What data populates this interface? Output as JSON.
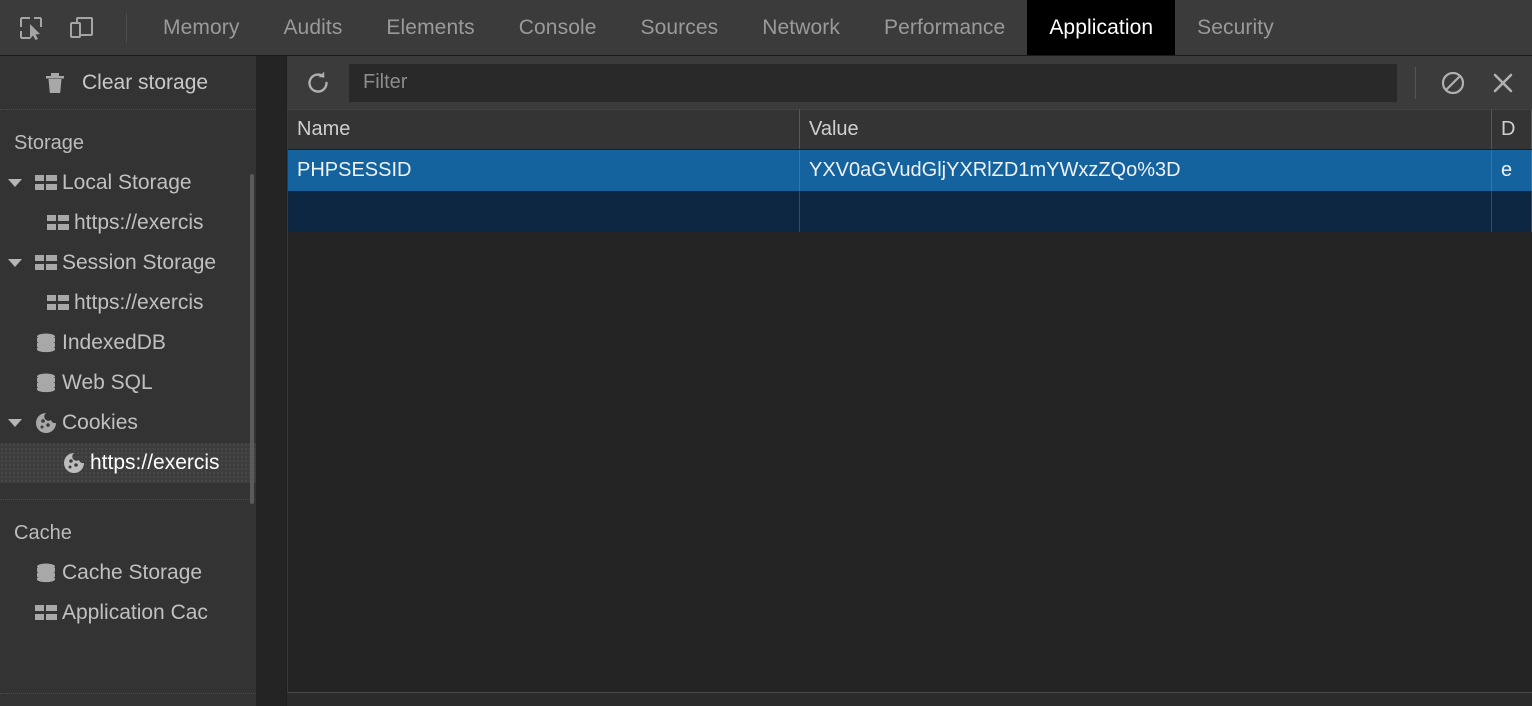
{
  "toolbar": {
    "inspect_icon": "inspect-element-icon",
    "device_icon": "device-toolbar-icon"
  },
  "tabs": [
    {
      "label": "Memory",
      "active": false
    },
    {
      "label": "Audits",
      "active": false
    },
    {
      "label": "Elements",
      "active": false
    },
    {
      "label": "Console",
      "active": false
    },
    {
      "label": "Sources",
      "active": false
    },
    {
      "label": "Network",
      "active": false
    },
    {
      "label": "Performance",
      "active": false
    },
    {
      "label": "Application",
      "active": true
    },
    {
      "label": "Security",
      "active": false
    }
  ],
  "sidebar": {
    "clear_storage": {
      "label": "Clear storage",
      "icon": "trash-icon"
    },
    "sections": [
      {
        "title": "Storage",
        "items": [
          {
            "label": "Local Storage",
            "icon": "table-icon",
            "indent": 1,
            "expandable": true,
            "expanded": true,
            "selected": false
          },
          {
            "label": "https://exercis",
            "icon": "table-icon",
            "indent": 2,
            "expandable": false,
            "expanded": false,
            "selected": false
          },
          {
            "label": "Session Storage",
            "icon": "table-icon",
            "indent": 1,
            "expandable": true,
            "expanded": true,
            "selected": false
          },
          {
            "label": "https://exercis",
            "icon": "table-icon",
            "indent": 2,
            "expandable": false,
            "expanded": false,
            "selected": false
          },
          {
            "label": "IndexedDB",
            "icon": "database-icon",
            "indent": 1,
            "expandable": false,
            "expanded": false,
            "selected": false
          },
          {
            "label": "Web SQL",
            "icon": "database-icon",
            "indent": 1,
            "expandable": false,
            "expanded": false,
            "selected": false
          },
          {
            "label": "Cookies",
            "icon": "cookie-icon",
            "indent": 1,
            "expandable": true,
            "expanded": true,
            "selected": false
          },
          {
            "label": "https://exercis",
            "icon": "cookie-icon",
            "indent": 3,
            "expandable": false,
            "expanded": false,
            "selected": true
          }
        ]
      },
      {
        "title": "Cache",
        "items": [
          {
            "label": "Cache Storage",
            "icon": "database-icon",
            "indent": 1,
            "expandable": false,
            "expanded": false,
            "selected": false
          },
          {
            "label": "Application Cac",
            "icon": "table-icon",
            "indent": 1,
            "expandable": false,
            "expanded": false,
            "selected": false
          }
        ]
      }
    ]
  },
  "filterbar": {
    "refresh_icon": "refresh-icon",
    "filter_placeholder": "Filter",
    "filter_value": "",
    "clear_all_icon": "clear-all-cookies-icon",
    "delete_icon": "delete-selected-icon"
  },
  "cookie_table": {
    "columns": [
      "Name",
      "Value",
      "D"
    ],
    "rows": [
      {
        "name": "PHPSESSID",
        "value": "YXV0aGVudGljYXRlZD1mYWxzZQo%3D",
        "domain": "e",
        "selected": true
      },
      {
        "name": "",
        "value": "",
        "domain": "",
        "selected": false
      }
    ]
  },
  "colors": {
    "selection_blue": "#14639e",
    "empty_row_blue": "#0d2642",
    "active_tab_bg": "#000000",
    "panel_bg": "#242424",
    "sidebar_bg": "#333333",
    "toolbar_bg": "#3b3b3b"
  }
}
